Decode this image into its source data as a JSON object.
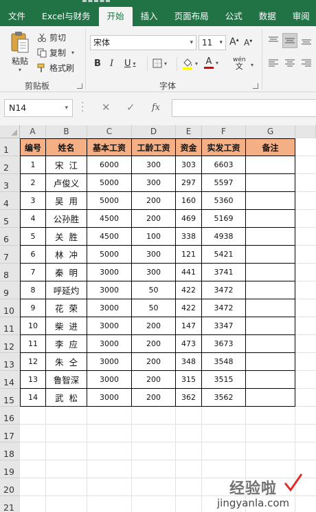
{
  "ribbon": {
    "tabs": [
      "文件",
      "Excel与财务",
      "开始",
      "插入",
      "页面布局",
      "公式",
      "数据",
      "审阅"
    ],
    "active_tab": "开始",
    "clipboard": {
      "paste_label": "粘贴",
      "cut_label": "剪切",
      "copy_label": "复制",
      "format_painter_label": "格式刷",
      "group_label": "剪贴板"
    },
    "font": {
      "font_name": "宋体",
      "font_size": "11",
      "bold": "B",
      "italic": "I",
      "underline": "U",
      "increase_size": "A",
      "decrease_size": "A",
      "pinyin": "wén",
      "font_color_glyph": "A",
      "group_label": "字体"
    }
  },
  "formula_bar": {
    "name_box": "N14",
    "fx_label": "fx",
    "formula": ""
  },
  "sheet": {
    "columns": [
      "A",
      "B",
      "C",
      "D",
      "E",
      "F",
      "G"
    ],
    "rows": [
      "1",
      "2",
      "3",
      "4",
      "5",
      "6",
      "7",
      "8",
      "9",
      "10",
      "11",
      "12",
      "13",
      "14",
      "15",
      "16",
      "17",
      "18",
      "19",
      "20",
      "21"
    ],
    "headers": [
      "编号",
      "姓名",
      "基本工资",
      "工龄工资",
      "资金",
      "实发工资",
      "备注"
    ],
    "data": [
      [
        "1",
        "宋  江",
        "6000",
        "300",
        "303",
        "6603",
        ""
      ],
      [
        "2",
        "卢俊义",
        "5000",
        "300",
        "297",
        "5597",
        ""
      ],
      [
        "3",
        "吴  用",
        "5000",
        "200",
        "160",
        "5360",
        ""
      ],
      [
        "4",
        "公孙胜",
        "4500",
        "200",
        "469",
        "5169",
        ""
      ],
      [
        "5",
        "关  胜",
        "4500",
        "100",
        "338",
        "4938",
        ""
      ],
      [
        "6",
        "林  冲",
        "5000",
        "300",
        "121",
        "5421",
        ""
      ],
      [
        "7",
        "秦  明",
        "3000",
        "300",
        "441",
        "3741",
        ""
      ],
      [
        "8",
        "呼延灼",
        "3000",
        "50",
        "422",
        "3472",
        ""
      ],
      [
        "9",
        "花  荣",
        "3000",
        "50",
        "422",
        "3472",
        ""
      ],
      [
        "10",
        "柴  进",
        "3000",
        "200",
        "147",
        "3347",
        ""
      ],
      [
        "11",
        "李  应",
        "3000",
        "200",
        "473",
        "3673",
        ""
      ],
      [
        "12",
        "朱  仝",
        "3000",
        "200",
        "348",
        "3548",
        ""
      ],
      [
        "13",
        "鲁智深",
        "3000",
        "200",
        "315",
        "3515",
        ""
      ],
      [
        "14",
        "武  松",
        "3000",
        "200",
        "362",
        "3562",
        ""
      ]
    ]
  },
  "watermark": {
    "line1": "经验啦",
    "line2": "jingyanla.com"
  },
  "colors": {
    "ribbon_green": "#217346",
    "header_fill": "#f4b084"
  }
}
